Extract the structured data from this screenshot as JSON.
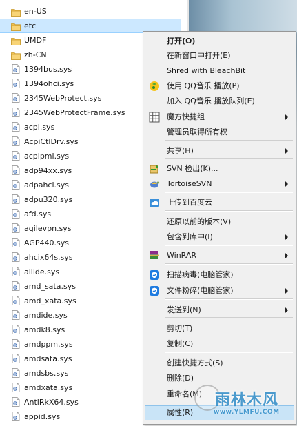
{
  "files": [
    {
      "name": "en-US",
      "type": "folder"
    },
    {
      "name": "etc",
      "type": "folder",
      "selected": true
    },
    {
      "name": "UMDF",
      "type": "folder"
    },
    {
      "name": "zh-CN",
      "type": "folder"
    },
    {
      "name": "1394bus.sys",
      "type": "sys"
    },
    {
      "name": "1394ohci.sys",
      "type": "sys"
    },
    {
      "name": "2345WebProtect.sys",
      "type": "sys"
    },
    {
      "name": "2345WebProtectFrame.sys",
      "type": "sys"
    },
    {
      "name": "acpi.sys",
      "type": "sys"
    },
    {
      "name": "AcpiCtlDrv.sys",
      "type": "sys"
    },
    {
      "name": "acpipmi.sys",
      "type": "sys"
    },
    {
      "name": "adp94xx.sys",
      "type": "sys"
    },
    {
      "name": "adpahci.sys",
      "type": "sys"
    },
    {
      "name": "adpu320.sys",
      "type": "sys"
    },
    {
      "name": "afd.sys",
      "type": "sys"
    },
    {
      "name": "agilevpn.sys",
      "type": "sys"
    },
    {
      "name": "AGP440.sys",
      "type": "sys"
    },
    {
      "name": "ahcix64s.sys",
      "type": "sys"
    },
    {
      "name": "aliide.sys",
      "type": "sys"
    },
    {
      "name": "amd_sata.sys",
      "type": "sys"
    },
    {
      "name": "amd_xata.sys",
      "type": "sys"
    },
    {
      "name": "amdide.sys",
      "type": "sys"
    },
    {
      "name": "amdk8.sys",
      "type": "sys"
    },
    {
      "name": "amdppm.sys",
      "type": "sys"
    },
    {
      "name": "amdsata.sys",
      "type": "sys"
    },
    {
      "name": "amdsbs.sys",
      "type": "sys"
    },
    {
      "name": "amdxata.sys",
      "type": "sys"
    },
    {
      "name": "AntiRkX64.sys",
      "type": "sys"
    },
    {
      "name": "appid.sys",
      "type": "sys"
    }
  ],
  "menu": {
    "items": [
      {
        "label": "打开(O)",
        "bold": true
      },
      {
        "label": "在新窗口中打开(E)"
      },
      {
        "label": "Shred with BleachBit"
      },
      {
        "label": "使用 QQ音乐 播放(P)",
        "icon": "qq-music-icon"
      },
      {
        "label": "加入 QQ音乐 播放队列(E)"
      },
      {
        "label": "魔方快捷组",
        "icon": "grid-icon",
        "submenu": true
      },
      {
        "label": "管理员取得所有权"
      },
      {
        "label": "共享(H)",
        "submenu": true
      },
      {
        "label": "SVN 检出(K)...",
        "icon": "svn-checkout-icon"
      },
      {
        "label": "TortoiseSVN",
        "icon": "tortoise-icon",
        "submenu": true
      },
      {
        "label": "上传到百度云",
        "icon": "baidu-cloud-icon"
      },
      {
        "label": "还原以前的版本(V)"
      },
      {
        "label": "包含到库中(I)",
        "submenu": true
      },
      {
        "label": "WinRAR",
        "icon": "winrar-icon",
        "submenu": true
      },
      {
        "label": "扫描病毒(电脑管家)",
        "icon": "shield-icon"
      },
      {
        "label": "文件粉碎(电脑管家)",
        "icon": "shield-icon",
        "submenu": true
      },
      {
        "label": "发送到(N)",
        "submenu": true
      },
      {
        "label": "剪切(T)"
      },
      {
        "label": "复制(C)"
      },
      {
        "label": "创建快捷方式(S)"
      },
      {
        "label": "删除(D)"
      },
      {
        "label": "重命名(M)"
      },
      {
        "label": "属性(R)",
        "highlight": true
      }
    ]
  },
  "watermark": {
    "brand": "雨林木风",
    "url": "www.YLMFU.COM"
  },
  "colors": {
    "selection": "#cce8ff",
    "menu_bg": "#f0f0f0",
    "highlight": "#c9e4f7",
    "folder": "#f2c14e"
  }
}
